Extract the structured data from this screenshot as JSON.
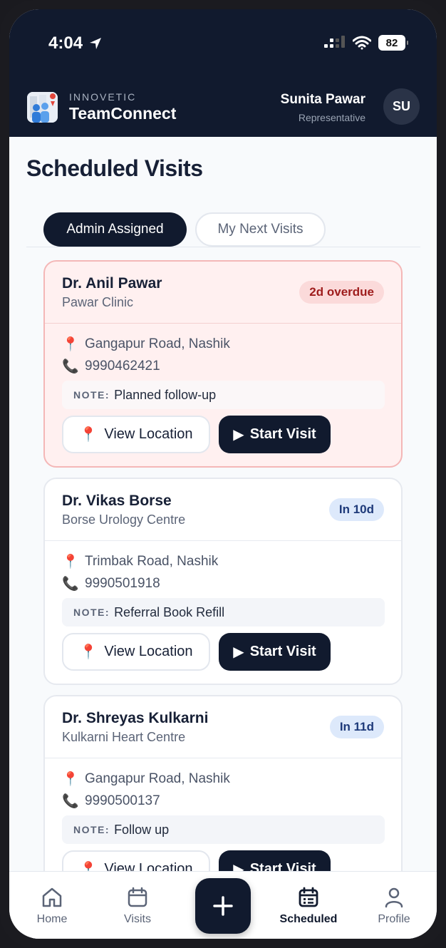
{
  "status": {
    "time": "4:04",
    "battery": "82"
  },
  "brand": {
    "sub": "INNOVETIC",
    "name": "TeamConnect"
  },
  "user": {
    "name": "Sunita Pawar",
    "role": "Representative",
    "initials": "SU"
  },
  "page_title": "Scheduled Visits",
  "tabs": [
    {
      "label": "Admin Assigned",
      "active": true
    },
    {
      "label": "My Next Visits",
      "active": false
    }
  ],
  "visits": [
    {
      "doctor": "Dr. Anil Pawar",
      "clinic": "Pawar Clinic",
      "badge": "2d overdue",
      "address": "Gangapur Road, Nashik",
      "phone": "9990462421",
      "note_key": "NOTE:",
      "note": "Planned follow-up",
      "view_location": "View Location",
      "start_visit": "Start Visit"
    },
    {
      "doctor": "Dr. Vikas Borse",
      "clinic": "Borse Urology Centre",
      "badge": "In 10d",
      "address": "Trimbak Road, Nashik",
      "phone": "9990501918",
      "note_key": "NOTE:",
      "note": "Referral Book Refill",
      "view_location": "View Location",
      "start_visit": "Start Visit"
    },
    {
      "doctor": "Dr. Shreyas Kulkarni",
      "clinic": "Kulkarni Heart Centre",
      "badge": "In 11d",
      "address": "Gangapur Road, Nashik",
      "phone": "9990500137",
      "note_key": "NOTE:",
      "note": "Follow up",
      "view_location": "View Location",
      "start_visit": "Start Visit"
    }
  ],
  "nav": {
    "home": "Home",
    "visits": "Visits",
    "scheduled": "Scheduled",
    "profile": "Profile"
  },
  "colors": {
    "navy": "#111a2e",
    "overdue_bg": "#fff0f0",
    "overdue_badge": "#fbdada",
    "future_badge": "#dde9fb"
  }
}
